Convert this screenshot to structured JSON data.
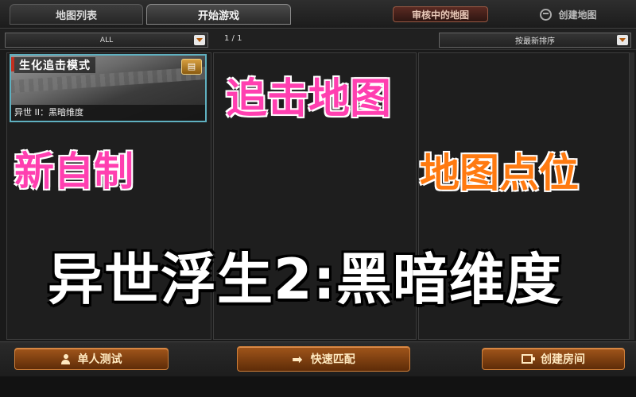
{
  "tabs": {
    "map_list": "地图列表",
    "start_game": "开始游戏",
    "under_review": "审核中的地图",
    "create_map": "创建地图"
  },
  "filters": {
    "category": "ALL",
    "page": "1 / 1",
    "sort": "按最新排序"
  },
  "map_card": {
    "mode": "生化追击模式",
    "name": "异世 II：黑暗维度"
  },
  "captions": {
    "chase_map": "追击地图",
    "new_custom": "新自制",
    "map_points": "地图点位",
    "title": "异世浮生2:黑暗维度"
  },
  "buttons": {
    "single_test": "单人测试",
    "quick_match": "快速匹配",
    "create_room": "创建房间"
  },
  "icons": {
    "dropdown": "chevron-down-icon",
    "create": "chat-bubble-icon",
    "single_test": "person-icon",
    "quick_match": "arrow-right-icon",
    "create_room": "room-icon",
    "chest": "treasure-chest-icon"
  },
  "colors": {
    "caption_pink": "#ff3fb0",
    "caption_orange": "#ff7a10",
    "button_orange": "#a0551a",
    "card_border": "#5fb0c0"
  }
}
